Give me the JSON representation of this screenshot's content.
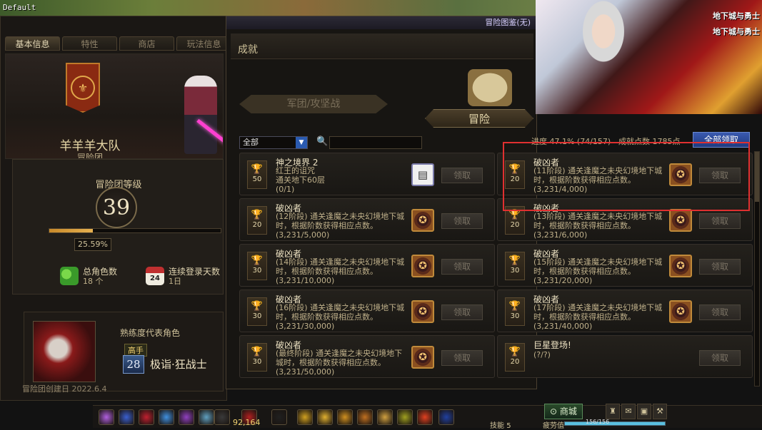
{
  "debug_label": "Default",
  "left_panel": {
    "tabs": [
      "基本信息",
      "特性",
      "商店",
      "玩法信息"
    ],
    "guild_name": "羊羊羊大队",
    "guild_type": "冒险团",
    "level_title": "冒险团等级",
    "level": "39",
    "level_progress": 0.2559,
    "level_progress_text": "25.59%",
    "total_chars_label": "总角色数",
    "total_chars_value": "18 个",
    "login_days_label": "连续登录天数",
    "login_days_value": "1日",
    "calendar_num": "24",
    "rep_title": "熟练度代表角色",
    "rep_rank": "高手",
    "rep_level": "28",
    "rep_name": "极诣·狂战士",
    "founded": "冒险团创建日 2022.6.4"
  },
  "window": {
    "titlebar": "冒险图鉴(无)",
    "section_title": "成就",
    "tab_legion": "军团/攻坚战",
    "tab_adventure": "冒险",
    "filter_value": "全部",
    "progress": "进度 47.1% (74/157)",
    "points": "成就点数 1785点",
    "claim_all": "全部领取",
    "claim_label": "领取"
  },
  "achievements_left": [
    {
      "points": "50",
      "title": "神之境界 2",
      "desc": "红王的诅咒\n通关地下60层",
      "progress": "(0/1)",
      "reward": "paper"
    },
    {
      "points": "20",
      "title": "破凶者",
      "desc": "(12阶段) 通关逢魔之未央幻境地下城时，根据阶数获得相应点数。",
      "progress": "(3,231/5,000)",
      "reward": "emblem"
    },
    {
      "points": "30",
      "title": "破凶者",
      "desc": "(14阶段) 通关逢魔之未央幻境地下城时，根据阶数获得相应点数。",
      "progress": "(3,231/10,000)",
      "reward": "emblem"
    },
    {
      "points": "30",
      "title": "破凶者",
      "desc": "(16阶段) 通关逢魔之未央幻境地下城时，根据阶数获得相应点数。",
      "progress": "(3,231/30,000)",
      "reward": "emblem"
    },
    {
      "points": "30",
      "title": "破凶者",
      "desc": "(最终阶段) 通关逢魔之未央幻境地下城时，根据阶数获得相应点数。",
      "progress": "(3,231/50,000)",
      "reward": "emblem"
    }
  ],
  "achievements_right": [
    {
      "points": "20",
      "title": "破凶者",
      "desc": "(11阶段) 通关逢魔之未央幻境地下城时，根据阶数获得相应点数。",
      "progress": "(3,231/4,000)",
      "reward": "emblem"
    },
    {
      "points": "20",
      "title": "破凶者",
      "desc": "(13阶段) 通关逢魔之未央幻境地下城时，根据阶数获得相应点数。",
      "progress": "(3,231/6,000)",
      "reward": "emblem"
    },
    {
      "points": "30",
      "title": "破凶者",
      "desc": "(15阶段) 通关逢魔之未央幻境地下城时，根据阶数获得相应点数。",
      "progress": "(3,231/20,000)",
      "reward": "emblem"
    },
    {
      "points": "30",
      "title": "破凶者",
      "desc": "(17阶段) 通关逢魔之未央幻境地下城时，根据阶数获得相应点数。",
      "progress": "(3,231/40,000)",
      "reward": "emblem"
    },
    {
      "points": "20",
      "title": "巨星登场!",
      "desc": "",
      "progress": "(?/?)",
      "reward": "none"
    }
  ],
  "ad": {
    "logo_line1": "地下城与勇士",
    "logo_line2": "地下城与勇士"
  },
  "hud": {
    "gold": "92,164",
    "shop": "商城",
    "skill_label": "技能",
    "skill_points": "5",
    "fatigue_label": "疲劳值",
    "fatigue_value": "156/156",
    "fatigue_fill": 1.0,
    "slot_number": "1"
  }
}
